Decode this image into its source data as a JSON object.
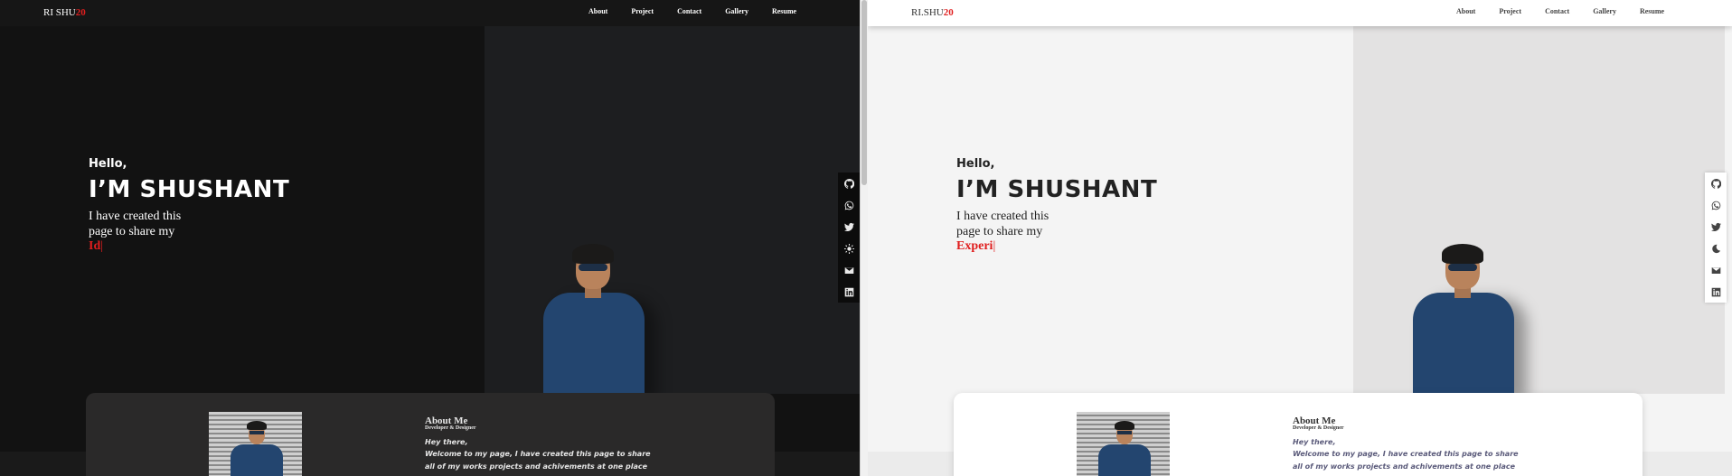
{
  "logo": {
    "prefix": "RI SHU",
    "prefix_light": "RI.SHU",
    "accent": "20"
  },
  "nav": {
    "items": [
      "About",
      "Project",
      "Contact",
      "Gallery",
      "Resume"
    ]
  },
  "hero": {
    "hello": "Hello,",
    "name": "I’M SHUSHANT",
    "description": "I have created this page to share my",
    "typed_dark": "Id",
    "typed_light": "Experi",
    "caret": "|"
  },
  "social_icons": [
    "github-icon",
    "whatsapp-icon",
    "twitter-icon",
    "theme-toggle-icon",
    "mail-icon",
    "linkedin-icon"
  ],
  "about": {
    "title": "About Me",
    "subtitle": "Developer & Designer",
    "greeting": "Hey there,",
    "body_dark": "Welcome to my page, I have created this page to share all of my works projects and achivements at one place you can",
    "body_light": "Welcome to my page, I have created this page to share all of my works projects and achivements at one place you can see my work on Github you can see my links by clicking the button"
  },
  "colors": {
    "accent": "#e01e1e",
    "dark_bg": "#121212",
    "light_bg": "#f4f4f4"
  }
}
